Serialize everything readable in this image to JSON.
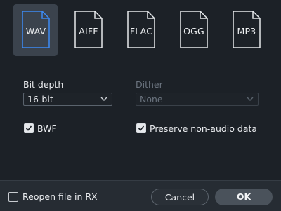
{
  "formats": [
    {
      "label": "WAV",
      "selected": true
    },
    {
      "label": "AIFF",
      "selected": false
    },
    {
      "label": "FLAC",
      "selected": false
    },
    {
      "label": "OGG",
      "selected": false
    },
    {
      "label": "MP3",
      "selected": false
    }
  ],
  "bit_depth": {
    "label": "Bit depth",
    "value": "16-bit"
  },
  "dither": {
    "label": "Dither",
    "value": "None",
    "enabled": false
  },
  "bwf": {
    "label": "BWF",
    "checked": true
  },
  "preserve": {
    "label": "Preserve non-audio data",
    "checked": true
  },
  "reopen": {
    "label": "Reopen file in RX",
    "checked": false
  },
  "buttons": {
    "cancel": "Cancel",
    "ok": "OK"
  },
  "colors": {
    "selected_icon": "#3d8bf5",
    "icon": "#e6e9ec"
  }
}
